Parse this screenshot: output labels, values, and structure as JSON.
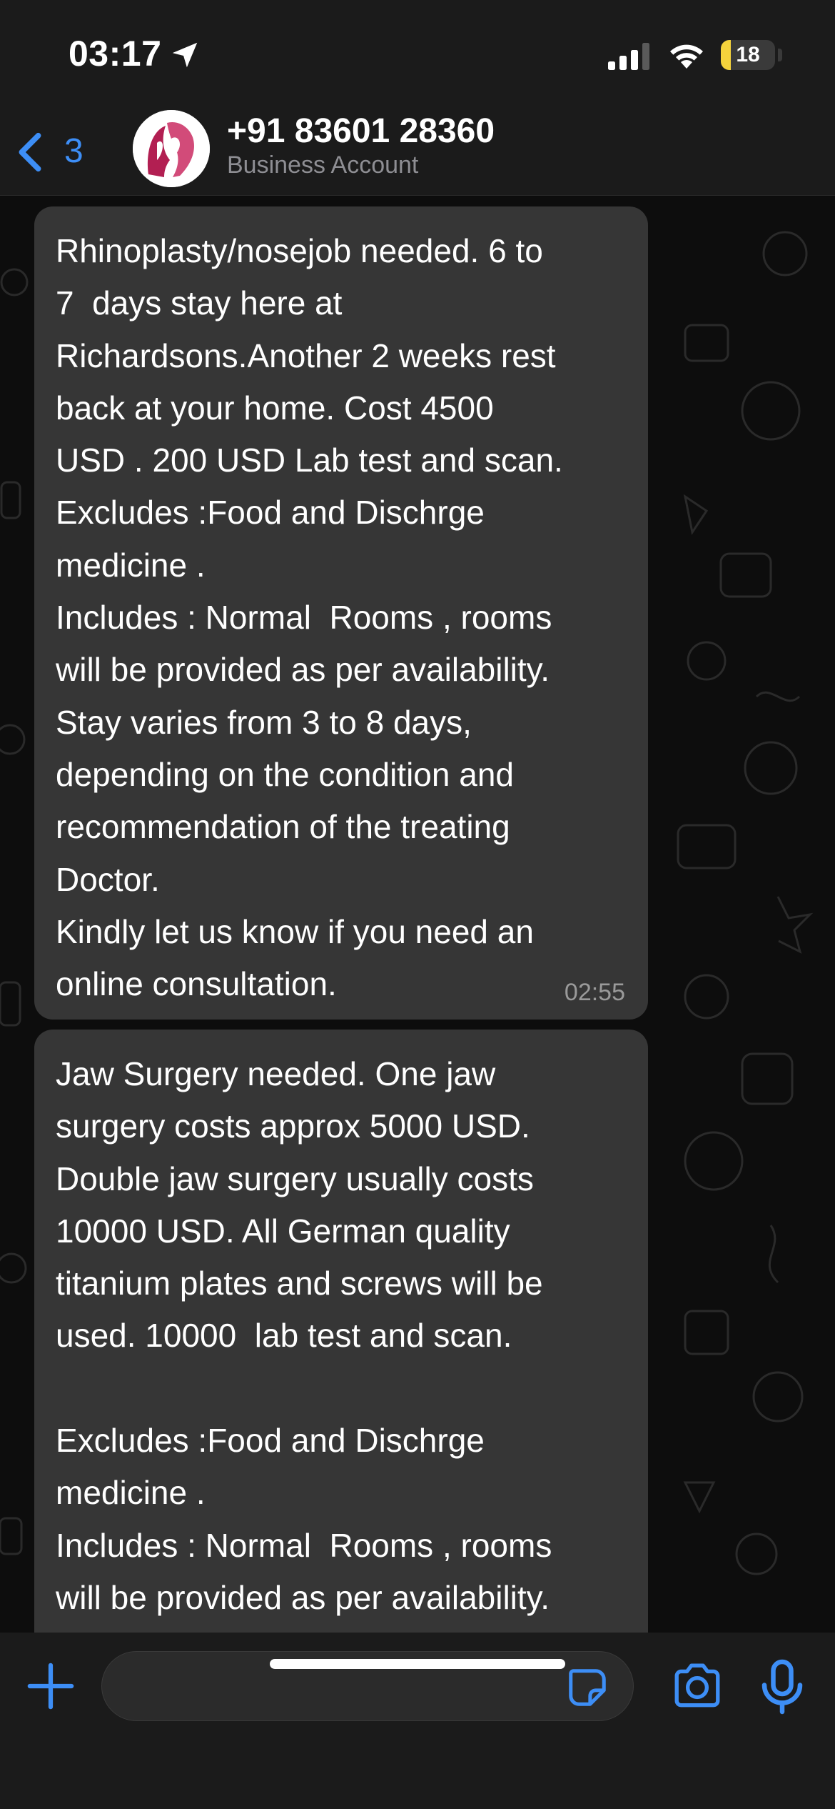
{
  "status_bar": {
    "time": "03:17",
    "battery_level": "18",
    "icons": [
      "location-arrow-icon",
      "signal-bars-icon",
      "wifi-icon",
      "battery-icon"
    ]
  },
  "header": {
    "back_count": "3",
    "contact_name": "+91 83601 28360",
    "subtitle": "Business Account"
  },
  "messages": [
    {
      "text": "Rhinoplasty/nosejob needed. 6 to\n7  days stay here at\nRichardsons.Another 2 weeks rest\nback at your home. Cost 4500\nUSD . 200 USD Lab test and scan.\nExcludes :Food and Dischrge\nmedicine .\nIncludes : Normal  Rooms , rooms\nwill be provided as per availability.\nStay varies from 3 to 8 days,\ndepending on the condition and\nrecommendation of the treating\nDoctor.\nKindly let us know if you need an\nonline consultation.",
      "time": "02:55"
    },
    {
      "text": "Jaw Surgery needed. One jaw\nsurgery costs approx 5000 USD.\nDouble jaw surgery usually costs\n10000 USD. All German quality\ntitanium plates and screws will be\nused. 10000  lab test and scan.\n\nExcludes :Food and Dischrge\nmedicine .\nIncludes : Normal  Rooms , rooms\nwill be provided as per availability."
    }
  ],
  "composer": {
    "placeholder": "",
    "icons": [
      "plus-icon",
      "sticker-icon",
      "camera-icon",
      "microphone-icon"
    ]
  },
  "colors": {
    "accent": "#3d8ef6",
    "bubble": "#363636",
    "bar": "#1b1b1b",
    "battery": "#f5d33c"
  }
}
